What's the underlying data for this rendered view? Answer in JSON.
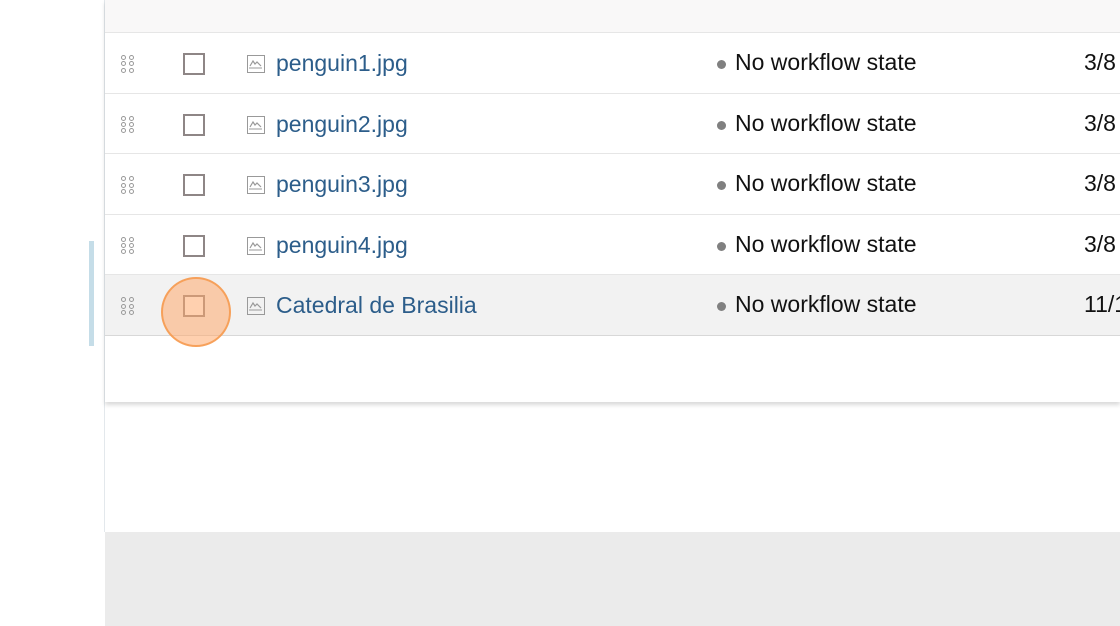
{
  "table": {
    "rows": [
      {
        "name": "penguin1.jpg",
        "status": "No workflow state",
        "date": "3/8"
      },
      {
        "name": "penguin2.jpg",
        "status": "No workflow state",
        "date": "3/8"
      },
      {
        "name": "penguin3.jpg",
        "status": "No workflow state",
        "date": "3/8"
      },
      {
        "name": "penguin4.jpg",
        "status": "No workflow state",
        "date": "3/8"
      },
      {
        "name": "Catedral de Brasilia",
        "status": "No workflow state",
        "date": "11/1",
        "highlighted": true
      }
    ]
  },
  "colors": {
    "link": "#2c5d8a",
    "accent": "#c5dde8",
    "click_indicator": "#ffaa6e"
  }
}
